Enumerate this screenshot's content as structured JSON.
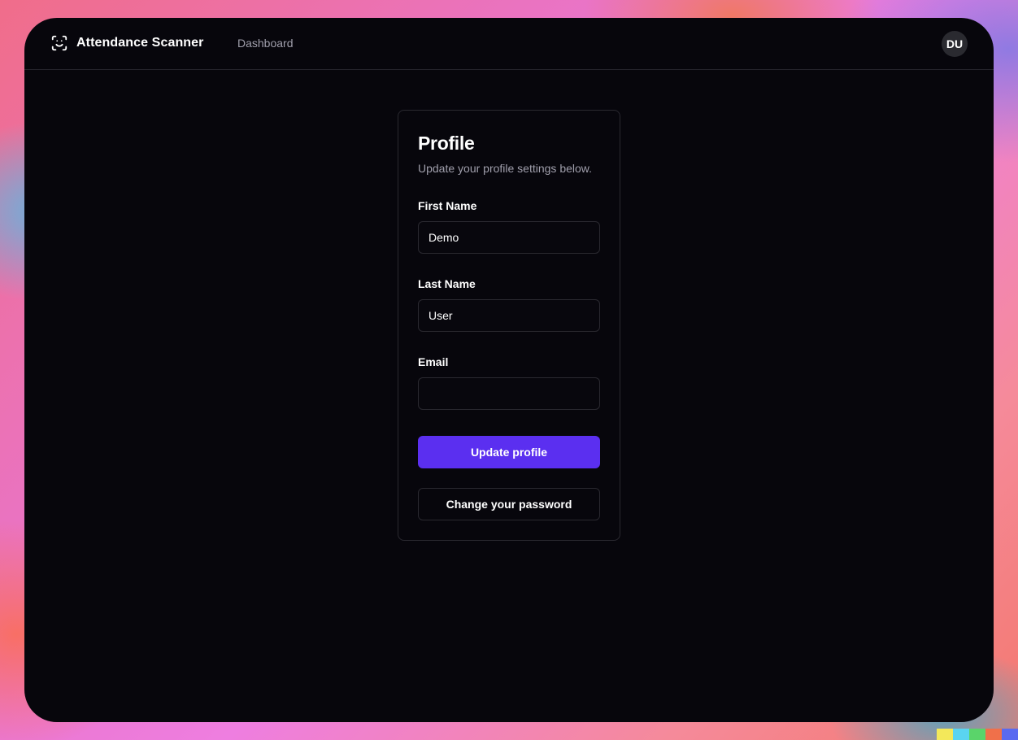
{
  "app": {
    "name": "Attendance Scanner",
    "logo_icon": "face-scan-icon"
  },
  "nav": {
    "dashboard_label": "Dashboard"
  },
  "user": {
    "avatar_initials": "DU"
  },
  "profile": {
    "title": "Profile",
    "description": "Update your profile settings below.",
    "fields": {
      "first_name": {
        "label": "First Name",
        "value": "Demo"
      },
      "last_name": {
        "label": "Last Name",
        "value": "User"
      },
      "email": {
        "label": "Email",
        "value": "",
        "obscured": true
      }
    },
    "update_button_label": "Update profile",
    "change_password_label": "Change your password"
  },
  "colors": {
    "accent": "#5b2ff0",
    "background": "#07060c",
    "muted_text": "#a09fac",
    "border": "#2a2930"
  }
}
